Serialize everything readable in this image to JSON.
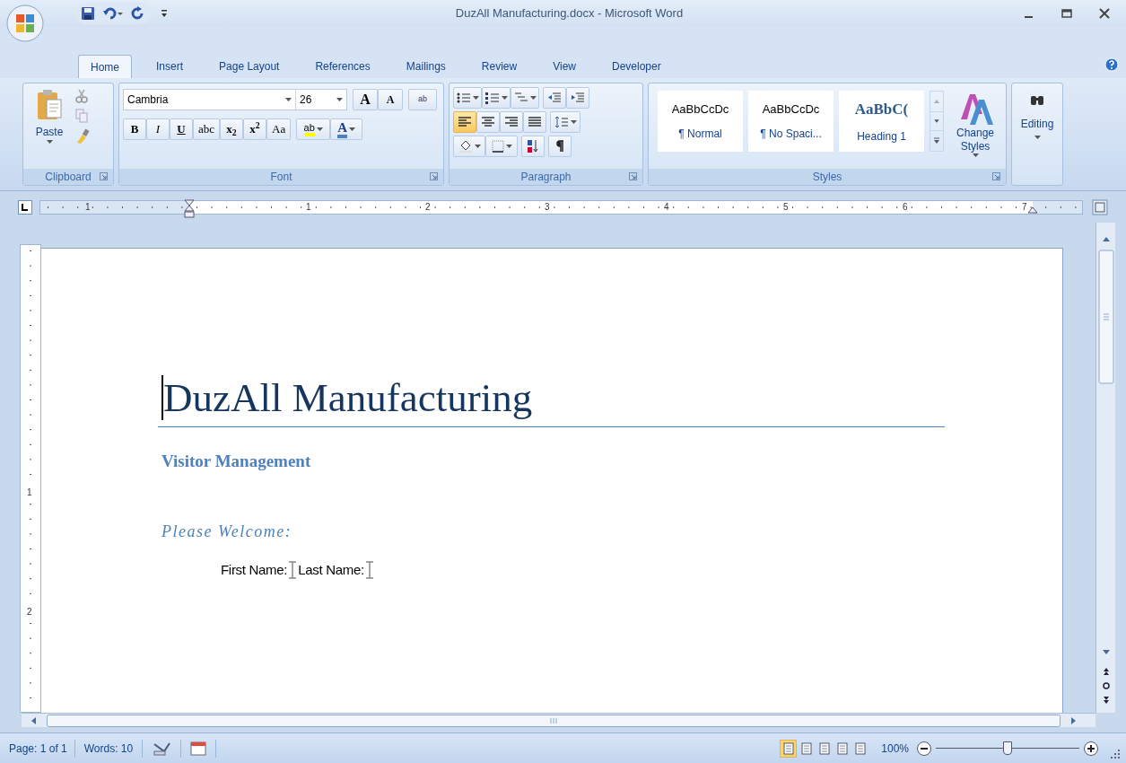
{
  "window": {
    "title": "DuzAll Manufacturing.docx - Microsoft Word"
  },
  "tabs": [
    {
      "label": "Home",
      "selected": true
    },
    {
      "label": "Insert",
      "selected": false
    },
    {
      "label": "Page Layout",
      "selected": false
    },
    {
      "label": "References",
      "selected": false
    },
    {
      "label": "Mailings",
      "selected": false
    },
    {
      "label": "Review",
      "selected": false
    },
    {
      "label": "View",
      "selected": false
    },
    {
      "label": "Developer",
      "selected": false
    }
  ],
  "clipboard": {
    "label": "Clipboard",
    "paste": "Paste"
  },
  "font": {
    "label": "Font",
    "font_name": "Cambria",
    "font_size": "26",
    "grow": "A",
    "shrink": "A",
    "clear": "ab",
    "format_buttons": [
      {
        "kind": "bold",
        "label": "B"
      },
      {
        "kind": "italic",
        "label": "I"
      },
      {
        "kind": "underline",
        "label": "U"
      },
      {
        "kind": "strike",
        "label": "abc"
      },
      {
        "kind": "sub",
        "label": "x$_{2}$"
      },
      {
        "kind": "sup",
        "label": "x$^{2}$"
      },
      {
        "kind": "case",
        "label": "Aa"
      }
    ],
    "highlight": "ab",
    "font_color": "A"
  },
  "paragraph": {
    "label": "Paragraph",
    "alignments": [
      {
        "selected": true
      },
      {
        "selected": false
      },
      {
        "selected": false
      },
      {
        "selected": false
      }
    ]
  },
  "styles": {
    "label": "Styles",
    "gallery": [
      {
        "kind": "normal",
        "sample": "AaBbCcDc",
        "name": "¶ Normal"
      },
      {
        "kind": "normal",
        "sample": "AaBbCcDc",
        "name": "¶ No Spaci..."
      },
      {
        "kind": "heading",
        "sample": "AaBbC(",
        "name": "Heading 1"
      }
    ],
    "change_styles": "Change Styles"
  },
  "editing": {
    "label": "Editing"
  },
  "ruler": {
    "numbers": [
      "1",
      "1",
      "2",
      "3",
      "4",
      "5",
      "6",
      "7"
    ]
  },
  "vertical_ruler": {
    "numbers": [
      "1",
      "2"
    ]
  },
  "document": {
    "title": "DuzAll Manufacturing",
    "subtitle": "Visitor Management",
    "heading": "Please Welcome:",
    "fields": [
      {
        "label": "First Name:"
      },
      {
        "label": "Last Name:"
      }
    ]
  },
  "status_bar": {
    "page": "Page: 1 of 1",
    "words": "Words: 10",
    "views": [
      {
        "selected": true
      },
      {
        "selected": false
      },
      {
        "selected": false
      },
      {
        "selected": false
      },
      {
        "selected": false
      }
    ],
    "zoom": "100%",
    "zoom_slider": {
      "level": 0.5
    }
  }
}
